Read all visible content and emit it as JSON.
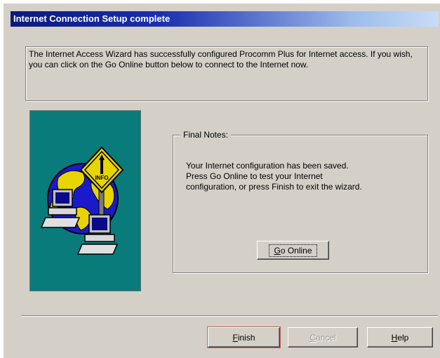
{
  "window": {
    "title": "Internet Connection Setup complete"
  },
  "intro": {
    "text": "The Internet Access Wizard has successfully configured Procomm Plus for Internet access.  If you wish, you can click on the Go Online button below to connect to the Internet now."
  },
  "illustration": {
    "sign_text": "INFO",
    "background_color": "#0a7b7b",
    "icons": [
      "globe-icon",
      "info-road-sign-icon",
      "computer-icon"
    ]
  },
  "final_notes": {
    "legend": "Final Notes:",
    "text": "Your Internet configuration has been saved.\nPress Go Online to test your Internet\nconfiguration, or press Finish to exit the wizard.",
    "go_online_label": "Go Online"
  },
  "buttons": {
    "finish": "Finish",
    "cancel": "Cancel",
    "help": "Help"
  },
  "colors": {
    "dialog_face": "#d4d0c8",
    "titlebar_start": "#0a1a7e",
    "titlebar_end": "#c8dcf6"
  }
}
